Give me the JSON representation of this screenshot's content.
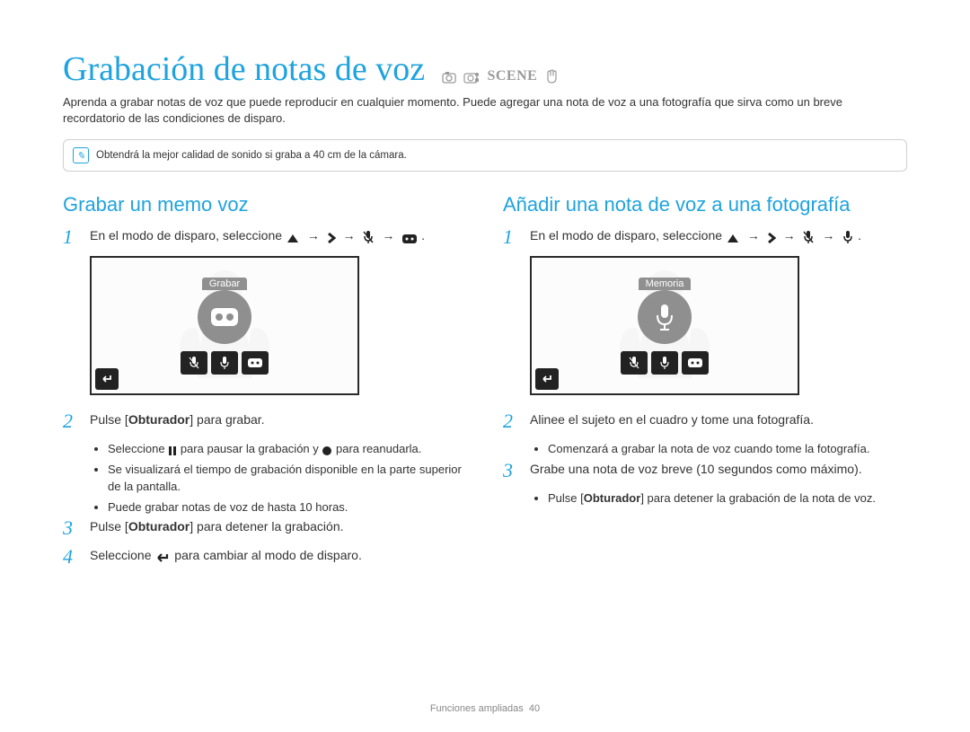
{
  "title": "Grabación de notas de voz",
  "intro": "Aprenda a grabar notas de voz que puede reproducir en cualquier momento. Puede agregar una nota de voz a una fotografía que sirva como un breve recordatorio de las condiciones de disparo.",
  "tip_text": "Obtendrá la mejor calidad de sonido si graba a 40 cm de la cámara.",
  "scene_label": "SCENE",
  "left": {
    "heading": "Grabar un memo voz",
    "step1_a": "En el modo de disparo, seleccione ",
    "step1_seq_end": ".",
    "screen_label": "Grabar",
    "step2": "Pulse [",
    "step2_bold": "Obturador",
    "step2_end": "] para grabar.",
    "bullets": [
      "Seleccione  para pausar la grabación y  para reanudarla.",
      "Se visualizará el tiempo de grabación disponible en la parte superior de la pantalla.",
      "Puede grabar notas de voz de hasta 10 horas."
    ],
    "step3_a": "Pulse [",
    "step3_bold": "Obturador",
    "step3_b": "] para detener la grabación.",
    "step4_a": "Seleccione ",
    "step4_b": " para cambiar al modo de disparo."
  },
  "right": {
    "heading": "Añadir una nota de voz a una fotografía",
    "step1_a": "En el modo de disparo, seleccione ",
    "step1_seq_end": ".",
    "screen_label": "Memoria",
    "step2": "Alinee el sujeto en el cuadro y tome una fotografía.",
    "bullets2": [
      "Comenzará a grabar la nota de voz cuando tome la fotografía."
    ],
    "step3": "Grabe una nota de voz breve (10 segundos como máximo).",
    "bullets3_a": "Pulse [",
    "bullets3_bold": "Obturador",
    "bullets3_b": "] para detener la grabación de la nota de voz."
  },
  "footer_section": "Funciones ampliadas",
  "footer_page": "40",
  "arrow": "→"
}
